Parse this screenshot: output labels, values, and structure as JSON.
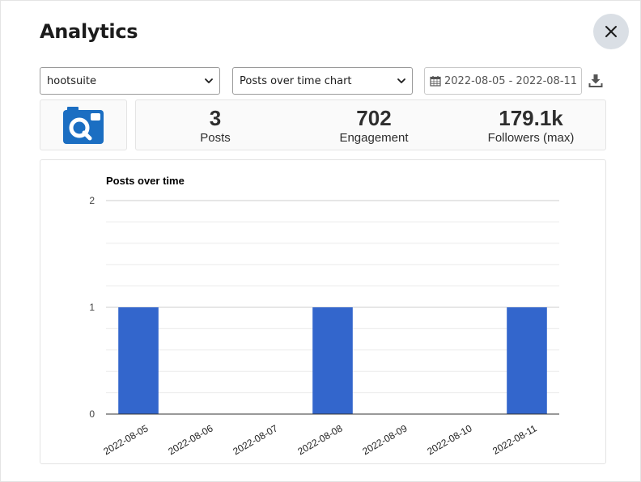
{
  "dialog": {
    "title": "Analytics",
    "close_icon": "close-icon"
  },
  "filters": {
    "account": {
      "selected": "hootsuite"
    },
    "report": {
      "selected": "Posts over time chart"
    },
    "date_range": {
      "value": "2022-08-05 - 2022-08-11",
      "icon": "calendar-icon"
    },
    "download_icon": "download-icon"
  },
  "account_logo": {
    "icon": "camera-search-logo"
  },
  "stats": [
    {
      "value": "3",
      "label": "Posts"
    },
    {
      "value": "702",
      "label": "Engagement"
    },
    {
      "value": "179.1k",
      "label": "Followers (max)"
    }
  ],
  "colors": {
    "bar": "#3366cc",
    "logo": "#1b6ec2",
    "close_bg": "#dadfe5"
  },
  "chart_data": {
    "type": "bar",
    "title": "Posts over time",
    "categories": [
      "2022-08-05",
      "2022-08-06",
      "2022-08-07",
      "2022-08-08",
      "2022-08-09",
      "2022-08-10",
      "2022-08-11"
    ],
    "values": [
      1,
      0,
      0,
      1,
      0,
      0,
      1
    ],
    "ylim": [
      0,
      2
    ],
    "yticks": [
      0,
      1,
      2
    ],
    "grid": true,
    "legend": "none"
  }
}
